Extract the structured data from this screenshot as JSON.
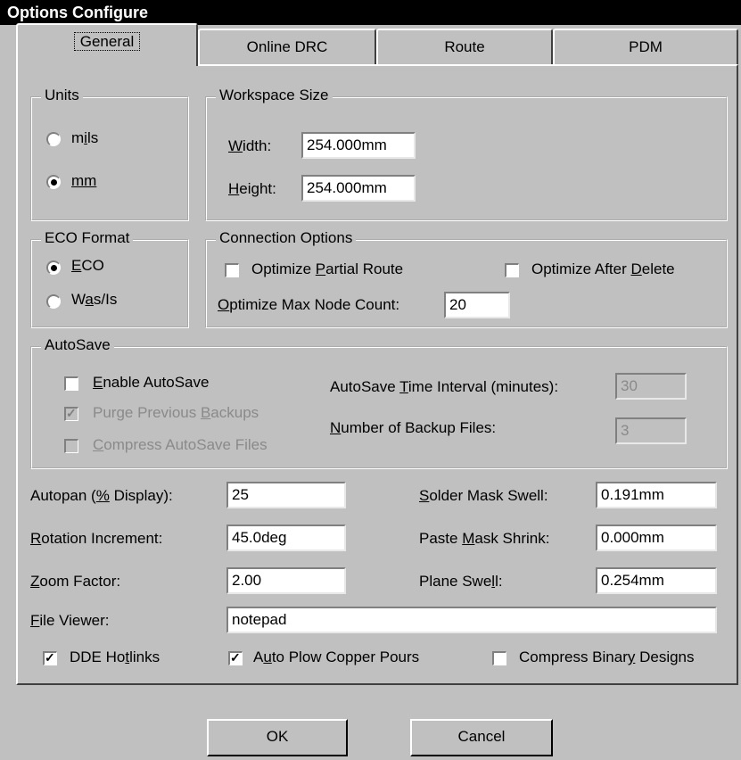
{
  "window": {
    "title": "Options Configure"
  },
  "tabs": [
    "General",
    "Online DRC",
    "Route",
    "PDM"
  ],
  "units": {
    "title": "Units",
    "mils_label": "mils",
    "mm_label": "mm",
    "selected": "mm"
  },
  "workspace": {
    "title": "Workspace Size",
    "width_label": "Width:",
    "width_value": "254.000mm",
    "height_label": "Height:",
    "height_value": "254.000mm"
  },
  "eco": {
    "title": "ECO Format",
    "eco_label": "ECO",
    "wasis_label": "Was/Is",
    "selected": "ECO"
  },
  "connection": {
    "title": "Connection Options",
    "partial_label": "Optimize Partial Route",
    "partial_checked": false,
    "after_delete_label": "Optimize After Delete",
    "after_delete_checked": false,
    "max_node_label": "Optimize Max Node Count:",
    "max_node_value": "20"
  },
  "autosave": {
    "title": "AutoSave",
    "enable_label": "Enable AutoSave",
    "enable_checked": false,
    "purge_label": "Purge Previous Backups",
    "purge_checked": true,
    "compress_label": "Compress AutoSave Files",
    "compress_checked": false,
    "interval_label": "AutoSave Time Interval (minutes):",
    "interval_value": "30",
    "backup_count_label": "Number of Backup Files:",
    "backup_count_value": "3"
  },
  "settings": {
    "autopan_label": "Autopan (% Display):",
    "autopan_value": "25",
    "rotation_label": "Rotation Increment:",
    "rotation_value": "45.0deg",
    "zoom_label": "Zoom Factor:",
    "zoom_value": "2.00",
    "file_viewer_label": "File Viewer:",
    "file_viewer_value": "notepad",
    "solder_label": "Solder Mask Swell:",
    "solder_value": "0.191mm",
    "paste_label": "Paste Mask Shrink:",
    "paste_value": "0.000mm",
    "plane_label": "Plane Swell:",
    "plane_value": "0.254mm"
  },
  "options": {
    "dde_label": "DDE Hotlinks",
    "dde_checked": true,
    "plow_label": "Auto Plow Copper Pours",
    "plow_checked": true,
    "binary_label": "Compress Binary Designs",
    "binary_checked": false
  },
  "buttons": {
    "ok": "OK",
    "cancel": "Cancel"
  }
}
